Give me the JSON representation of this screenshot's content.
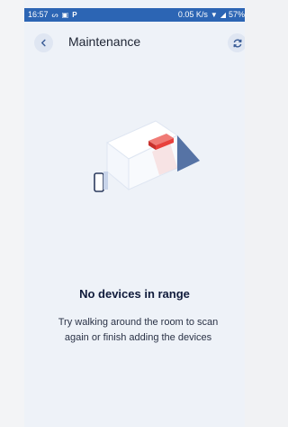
{
  "statusbar": {
    "time": "16:57",
    "left_icons": [
      "notification-icon",
      "message-icon",
      "p-app-icon"
    ],
    "p_label": "P",
    "speed": "0.05 K/s",
    "battery": "57%"
  },
  "header": {
    "title": "Maintenance"
  },
  "empty_state": {
    "title": "No devices in range",
    "description": "Try walking around the room to scan again or finish adding the devices"
  },
  "colors": {
    "statusbar": "#2c65b4",
    "background": "#eef2f8",
    "accent_red": "#e8403c",
    "icon_blue": "#3b5d97"
  }
}
